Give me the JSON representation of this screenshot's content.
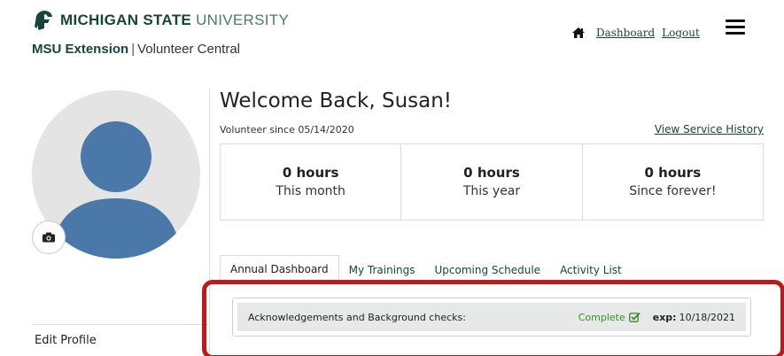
{
  "header": {
    "brand_strong": "MICHIGAN STATE",
    "brand_light": "UNIVERSITY",
    "sub_bold": "MSU Extension",
    "sub_sep": "|",
    "sub_normal": "Volunteer Central",
    "nav": {
      "dashboard": "Dashboard",
      "logout": "Logout"
    }
  },
  "profile": {
    "edit_label": "Edit Profile"
  },
  "welcome": {
    "title": "Welcome Back, Susan!",
    "since": "Volunteer since 05/14/2020",
    "history_link": "View Service History"
  },
  "stats": [
    {
      "value": "0 hours",
      "label": "This month"
    },
    {
      "value": "0 hours",
      "label": "This year"
    },
    {
      "value": "0 hours",
      "label": "Since forever!"
    }
  ],
  "tabs": [
    {
      "label": "Annual Dashboard",
      "active": true
    },
    {
      "label": "My Trainings",
      "active": false
    },
    {
      "label": "Upcoming Schedule",
      "active": false
    },
    {
      "label": "Activity List",
      "active": false
    }
  ],
  "acknowledgements": {
    "label": "Acknowledgements and Background checks:",
    "status": "Complete",
    "exp_label": "exp:",
    "exp_date": "10/18/2021"
  },
  "colors": {
    "brand_green": "#18453b",
    "status_green": "#3e8a2b",
    "highlight_red": "#b81c1c",
    "avatar_blue": "#4a78a8"
  },
  "icons": {
    "logo": "spartan-helmet-icon",
    "home": "home-icon",
    "menu": "hamburger-menu-icon",
    "camera": "camera-icon",
    "check": "check-square-icon"
  }
}
